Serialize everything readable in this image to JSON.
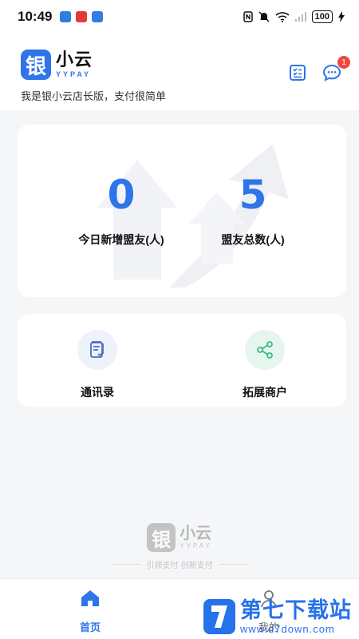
{
  "status_bar": {
    "time": "10:49",
    "battery": "100",
    "notif_colors": [
      "#2f7de1",
      "#e23a3a",
      "#2f7de1"
    ]
  },
  "header": {
    "logo_mark": "银",
    "logo_name": "小云",
    "logo_sub": "YYPAY",
    "tagline": "我是银小云店长版，支付很简单",
    "message_badge": "1"
  },
  "stats": {
    "today_new": {
      "value": "0",
      "label": "今日新增盟友(人)"
    },
    "total": {
      "value": "5",
      "label": "盟友总数(人)"
    }
  },
  "actions": [
    {
      "label": "通讯录",
      "icon": "contacts-icon"
    },
    {
      "label": "拓展商户",
      "icon": "share-icon"
    }
  ],
  "footer": {
    "logo_mark": "银",
    "logo_name": "小云",
    "logo_sub": "YYPAY",
    "slogan": "引领支付·创新支付"
  },
  "tabs": [
    {
      "label": "首页",
      "active": true
    },
    {
      "label": "我的",
      "active": false
    }
  ],
  "corner_watermark": {
    "title": "第七下载站",
    "url": "www.d7down.com"
  },
  "colors": {
    "accent": "#2f74e8",
    "badge": "#f0483e",
    "share_green": "#3cb784"
  }
}
